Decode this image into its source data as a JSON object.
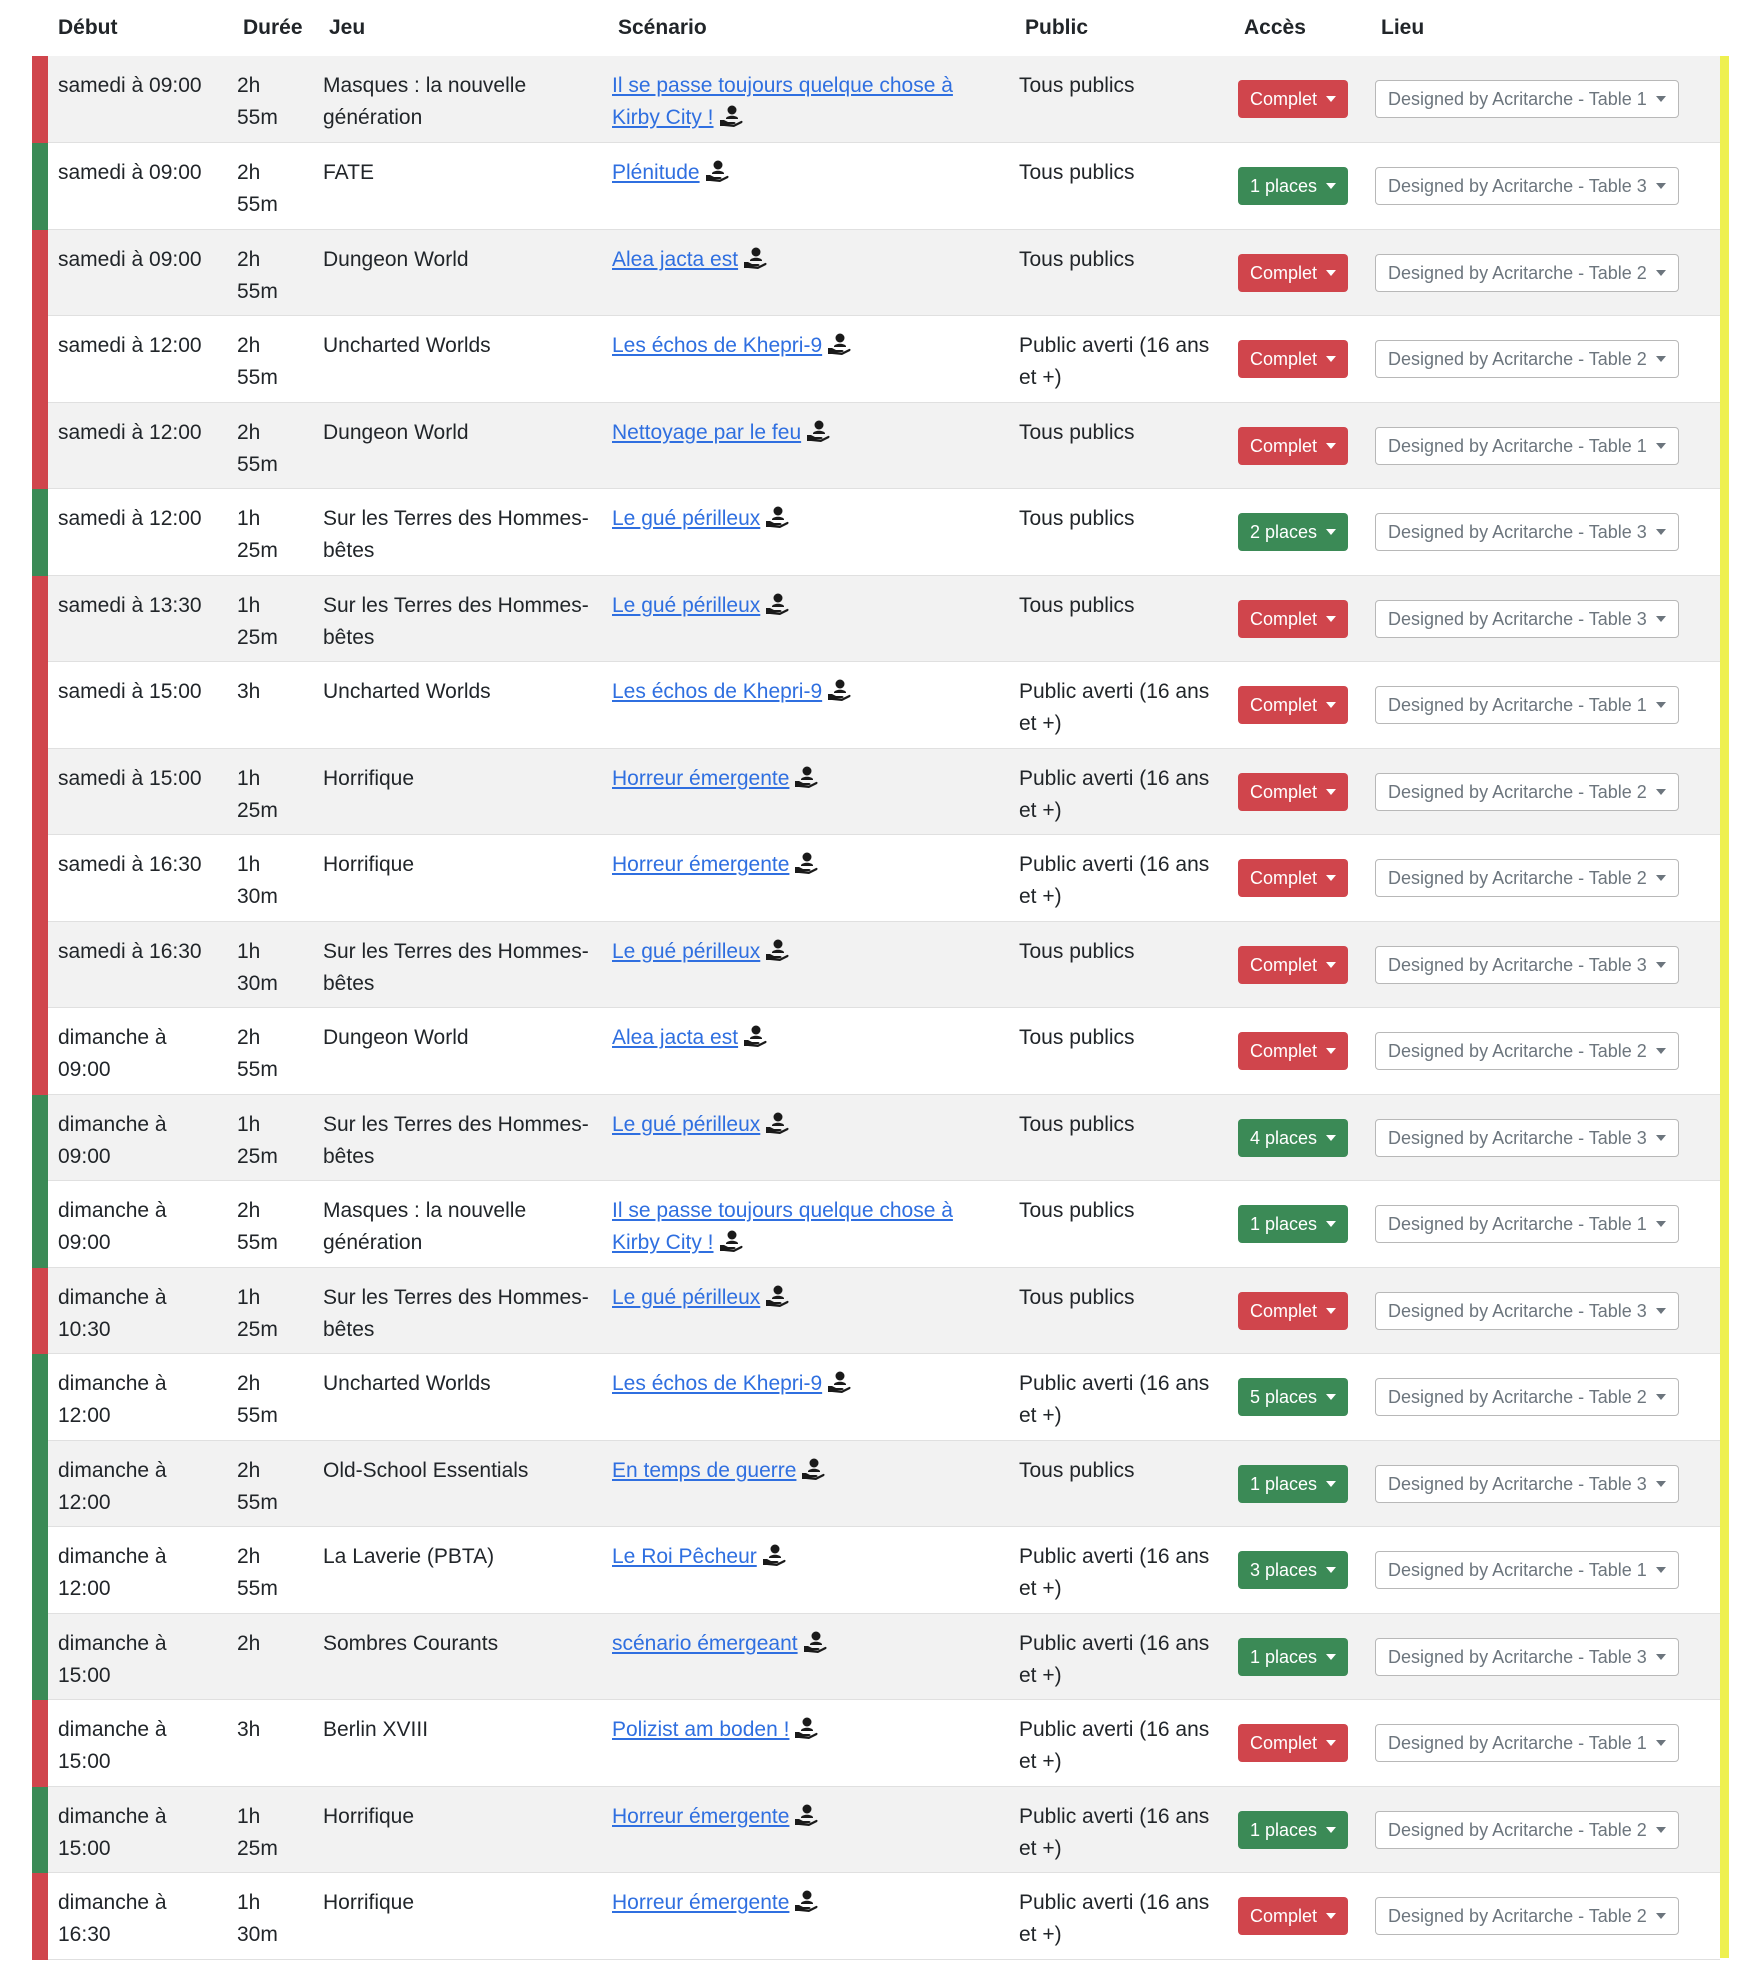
{
  "headers": {
    "debut": "Début",
    "duree": "Durée",
    "jeu": "Jeu",
    "scenario": "Scénario",
    "public": "Public",
    "acces": "Accès",
    "lieu": "Lieu"
  },
  "icons": {
    "gm": "game-master-hand-icon",
    "caret": "chevron-down-icon"
  },
  "colors": {
    "full": "#d0454c",
    "open": "#3b8a56",
    "link": "#2f6fe0",
    "sidebar": "#eef050"
  },
  "rows": [
    {
      "debut": "samedi à 09:00",
      "duree": "2h 55m",
      "jeu": "Masques : la nouvelle génération",
      "jeu_link": false,
      "scenario": "Il se passe toujours quelque chose à Kirby City !",
      "public": "Tous publics",
      "acces": "Complet",
      "status": "full",
      "lieu": "Designed by Acritarche - Table 1"
    },
    {
      "debut": "samedi à 09:00",
      "duree": "2h 55m",
      "jeu": "FATE",
      "jeu_link": true,
      "scenario": "Plénitude",
      "public": "Tous publics",
      "acces": "1 places",
      "status": "open",
      "lieu": "Designed by Acritarche - Table 3"
    },
    {
      "debut": "samedi à 09:00",
      "duree": "2h 55m",
      "jeu": "Dungeon World",
      "jeu_link": true,
      "scenario": "Alea jacta est",
      "public": "Tous publics",
      "acces": "Complet",
      "status": "full",
      "lieu": "Designed by Acritarche - Table 2"
    },
    {
      "debut": "samedi à 12:00",
      "duree": "2h 55m",
      "jeu": "Uncharted Worlds",
      "jeu_link": true,
      "scenario": "Les échos de Khepri-9",
      "public": "Public averti (16 ans et +)",
      "acces": "Complet",
      "status": "full",
      "lieu": "Designed by Acritarche - Table 2"
    },
    {
      "debut": "samedi à 12:00",
      "duree": "2h 55m",
      "jeu": "Dungeon World",
      "jeu_link": true,
      "scenario": "Nettoyage par le feu",
      "public": "Tous publics",
      "acces": "Complet",
      "status": "full",
      "lieu": "Designed by Acritarche - Table 1"
    },
    {
      "debut": "samedi à 12:00",
      "duree": "1h 25m",
      "jeu": "Sur les Terres des Hommes-bêtes",
      "jeu_link": false,
      "scenario": "Le gué périlleux",
      "public": "Tous publics",
      "acces": "2 places",
      "status": "open",
      "lieu": "Designed by Acritarche - Table 3"
    },
    {
      "debut": "samedi à 13:30",
      "duree": "1h 25m",
      "jeu": "Sur les Terres des Hommes-bêtes",
      "jeu_link": false,
      "scenario": "Le gué périlleux",
      "public": "Tous publics",
      "acces": "Complet",
      "status": "full",
      "lieu": "Designed by Acritarche - Table 3"
    },
    {
      "debut": "samedi à 15:00",
      "duree": "3h",
      "jeu": "Uncharted Worlds",
      "jeu_link": true,
      "scenario": "Les échos de Khepri-9",
      "public": "Public averti (16 ans et +)",
      "acces": "Complet",
      "status": "full",
      "lieu": "Designed by Acritarche - Table 1"
    },
    {
      "debut": "samedi à 15:00",
      "duree": "1h 25m",
      "jeu": "Horrifique",
      "jeu_link": true,
      "scenario": "Horreur émergente",
      "public": "Public averti (16 ans et +)",
      "acces": "Complet",
      "status": "full",
      "lieu": "Designed by Acritarche - Table 2"
    },
    {
      "debut": "samedi à 16:30",
      "duree": "1h 30m",
      "jeu": "Horrifique",
      "jeu_link": true,
      "scenario": "Horreur émergente",
      "public": "Public averti (16 ans et +)",
      "acces": "Complet",
      "status": "full",
      "lieu": "Designed by Acritarche - Table 2"
    },
    {
      "debut": "samedi à 16:30",
      "duree": "1h 30m",
      "jeu": "Sur les Terres des Hommes-bêtes",
      "jeu_link": false,
      "scenario": "Le gué périlleux",
      "public": "Tous publics",
      "acces": "Complet",
      "status": "full",
      "lieu": "Designed by Acritarche - Table 3"
    },
    {
      "debut": "dimanche à 09:00",
      "duree": "2h 55m",
      "jeu": "Dungeon World",
      "jeu_link": true,
      "scenario": "Alea jacta est",
      "public": "Tous publics",
      "acces": "Complet",
      "status": "full",
      "lieu": "Designed by Acritarche - Table 2"
    },
    {
      "debut": "dimanche à 09:00",
      "duree": "1h 25m",
      "jeu": "Sur les Terres des Hommes-bêtes",
      "jeu_link": false,
      "scenario": "Le gué périlleux",
      "public": "Tous publics",
      "acces": "4 places",
      "status": "open",
      "lieu": "Designed by Acritarche - Table 3"
    },
    {
      "debut": "dimanche à 09:00",
      "duree": "2h 55m",
      "jeu": "Masques : la nouvelle génération",
      "jeu_link": false,
      "scenario": "Il se passe toujours quelque chose à Kirby City !",
      "public": "Tous publics",
      "acces": "1 places",
      "status": "open",
      "lieu": "Designed by Acritarche - Table 1"
    },
    {
      "debut": "dimanche à 10:30",
      "duree": "1h 25m",
      "jeu": "Sur les Terres des Hommes-bêtes",
      "jeu_link": false,
      "scenario": "Le gué périlleux",
      "public": "Tous publics",
      "acces": "Complet",
      "status": "full",
      "lieu": "Designed by Acritarche - Table 3"
    },
    {
      "debut": "dimanche à 12:00",
      "duree": "2h 55m",
      "jeu": "Uncharted Worlds",
      "jeu_link": true,
      "scenario": "Les échos de Khepri-9",
      "public": "Public averti (16 ans et +)",
      "acces": "5 places",
      "status": "open",
      "lieu": "Designed by Acritarche - Table 2"
    },
    {
      "debut": "dimanche à 12:00",
      "duree": "2h 55m",
      "jeu": "Old-School Essentials",
      "jeu_link": false,
      "scenario": "En temps de guerre",
      "public": "Tous publics",
      "acces": "1 places",
      "status": "open",
      "lieu": "Designed by Acritarche - Table 3"
    },
    {
      "debut": "dimanche à 12:00",
      "duree": "2h 55m",
      "jeu": "La Laverie (PBTA)",
      "jeu_link": false,
      "scenario": "Le Roi Pêcheur",
      "public": "Public averti (16 ans et +)",
      "acces": "3 places",
      "status": "open",
      "lieu": "Designed by Acritarche - Table 1"
    },
    {
      "debut": "dimanche à 15:00",
      "duree": "2h",
      "jeu": "Sombres Courants",
      "jeu_link": false,
      "scenario": "scénario émergeant",
      "public": "Public averti (16 ans et +)",
      "acces": "1 places",
      "status": "open",
      "lieu": "Designed by Acritarche - Table 3"
    },
    {
      "debut": "dimanche à 15:00",
      "duree": "3h",
      "jeu": "Berlin XVIII",
      "jeu_link": true,
      "scenario": "Polizist am boden !",
      "public": "Public averti (16 ans et +)",
      "acces": "Complet",
      "status": "full",
      "lieu": "Designed by Acritarche - Table 1"
    },
    {
      "debut": "dimanche à 15:00",
      "duree": "1h 25m",
      "jeu": "Horrifique",
      "jeu_link": true,
      "scenario": "Horreur émergente",
      "public": "Public averti (16 ans et +)",
      "acces": "1 places",
      "status": "open",
      "lieu": "Designed by Acritarche - Table 2"
    },
    {
      "debut": "dimanche à 16:30",
      "duree": "1h 30m",
      "jeu": "Horrifique",
      "jeu_link": true,
      "scenario": "Horreur émergente",
      "public": "Public averti (16 ans et +)",
      "acces": "Complet",
      "status": "full",
      "lieu": "Designed by Acritarche - Table 2"
    }
  ]
}
